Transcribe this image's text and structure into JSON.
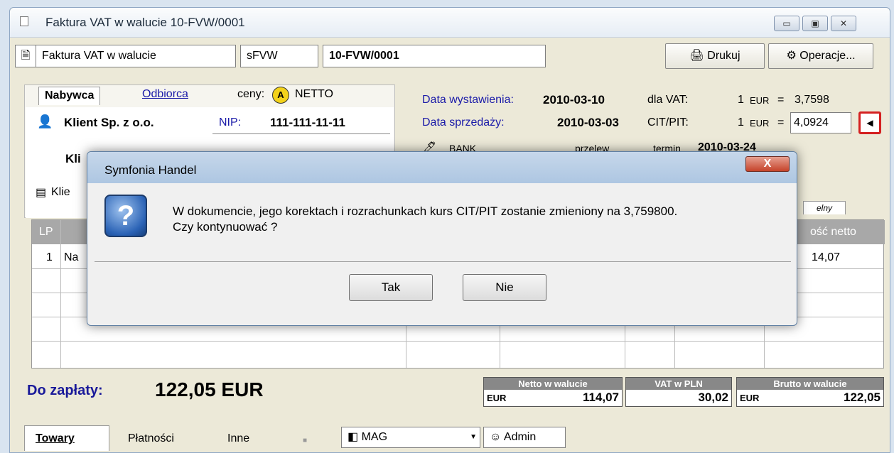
{
  "window": {
    "title": "Faktura VAT w walucie 10-FVW/0001",
    "buttons": [
      "▭",
      "▣",
      "✕"
    ]
  },
  "doc": {
    "type": "Faktura VAT w walucie",
    "code": "sFVW",
    "number": "10-FVW/0001"
  },
  "toolbar": {
    "print": "Drukuj",
    "operations": "Operacje..."
  },
  "buyer": {
    "tab_buyer": "Nabywca",
    "tab_recipient": "Odbiorca",
    "prices_label": "ceny:",
    "prices_mode_badge": "A",
    "prices_mode": "NETTO",
    "name": "Klient Sp. z o.o.",
    "nip_label": "NIP:",
    "nip": "111-111-11-11",
    "name2": "Kli",
    "contact": "Klie"
  },
  "dates": {
    "issue_label": "Data wystawienia:",
    "issue": "2010-03-10",
    "vat_label": "dla VAT:",
    "vat_qty": "1",
    "vat_cur": "EUR",
    "vat_eq": "=",
    "vat_rate": "3,7598",
    "sale_label": "Data sprzedaży:",
    "sale": "2010-03-03",
    "cit_label": "CIT/PIT:",
    "cit_qty": "1",
    "cit_cur": "EUR",
    "cit_eq": "=",
    "cit_rate": "4,0924",
    "payment": "BANK",
    "payment2": "przelew",
    "term_label": "termin",
    "term": "2010-03-24",
    "tab_right": "elny"
  },
  "grid": {
    "col_lp": "LP",
    "col_netto": "ość netto",
    "row1": {
      "lp": "1",
      "name": "Na",
      "netto": "14,07"
    }
  },
  "totals": {
    "label": "Do zapłaty:",
    "amount": "122,05 EUR",
    "netto_head": "Netto w walucie",
    "netto_cur": "EUR",
    "netto_val": "114,07",
    "vat_head": "VAT w PLN",
    "vat_val": "30,02",
    "brutto_head": "Brutto w walucie",
    "brutto_cur": "EUR",
    "brutto_val": "122,05"
  },
  "tabs": {
    "t1": "Towary",
    "t2": "Płatności",
    "t3": "Inne",
    "mag": "MAG",
    "admin": "Admin"
  },
  "dialog": {
    "title": "Symfonia Handel",
    "close": "X",
    "icon": "?",
    "line1": "W dokumencie, jego korektach i rozrachunkach kurs CIT/PIT zostanie zmieniony na 3,759800.",
    "line2": "Czy kontynuować ?",
    "yes": "Tak",
    "no": "Nie"
  }
}
